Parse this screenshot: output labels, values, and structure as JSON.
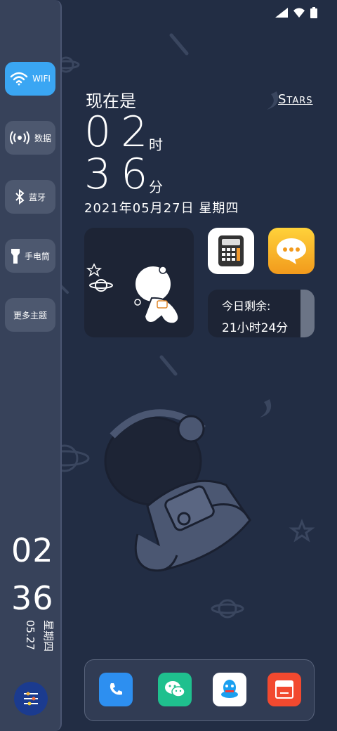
{
  "sidebar": {
    "items": [
      {
        "label": "WIFI",
        "icon": "wifi-icon",
        "active": true
      },
      {
        "label": "数据",
        "icon": "cellular-data-icon",
        "active": false
      },
      {
        "label": "蓝牙",
        "icon": "bluetooth-icon",
        "active": false
      },
      {
        "label": "手电筒",
        "icon": "flashlight-icon",
        "active": false
      },
      {
        "label": "更多主题",
        "icon": "",
        "active": false
      }
    ],
    "hour": "02",
    "minute": "36",
    "date": "05.27",
    "weekday": "星期四"
  },
  "clock": {
    "label": "现在是",
    "hour": "02",
    "hour_unit": "时",
    "minute": "36",
    "minute_unit": "分",
    "date_line": "2021年05月27日  星期四"
  },
  "stars_link": "Stars",
  "remaining": {
    "title": "今日剩余:",
    "value": "21小时24分"
  },
  "apps": [
    "calculator-icon",
    "messages-icon"
  ],
  "dock": [
    "phone-icon",
    "wechat-icon",
    "qq-icon",
    "toutiao-icon"
  ],
  "colors": {
    "background": "#222d44",
    "sidebar": "#37425a",
    "accent": "#3aa6f3",
    "widget": "#1d2435"
  }
}
